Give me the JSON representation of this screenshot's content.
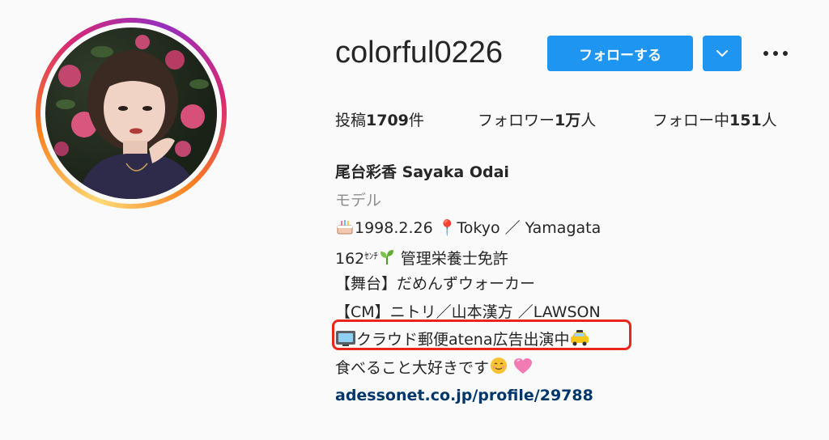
{
  "profile": {
    "username": "colorful0226",
    "follow_label": "フォローする",
    "stats": {
      "posts_prefix": "投稿",
      "posts_value": "1709",
      "posts_suffix": "件",
      "followers_prefix": "フォロワー",
      "followers_value": "1万",
      "followers_suffix": "人",
      "following_prefix": "フォロー中",
      "following_value": "151",
      "following_suffix": "人"
    },
    "bio": {
      "full_name": "尾台彩香 Sayaka Odai",
      "category": "モデル",
      "line1": "1998.2.26 📍Tokyo ／ Yamagata",
      "line2_a": "162",
      "line2_unit": "ｾﾝﾁ",
      "line2_b": " 管理栄養士免許",
      "line3": "【舞台】だめんずウォーカー",
      "line4": "【CM】ニトリ／山本漢方 ／LAWSON",
      "line5": "クラウド郵便atena広告出演中",
      "line6": "食べること大好きです",
      "link": "adessonet.co.jp/profile/29788"
    }
  },
  "colors": {
    "accent": "#1e95f0",
    "link": "#00376b",
    "highlight": "#e8261c"
  },
  "icons": [
    "chevron-down-icon",
    "more-dots-icon",
    "cake-icon",
    "pin-icon",
    "seedling-icon",
    "tv-icon",
    "taxi-icon",
    "smiling-face-icon",
    "pink-heart-icon"
  ]
}
